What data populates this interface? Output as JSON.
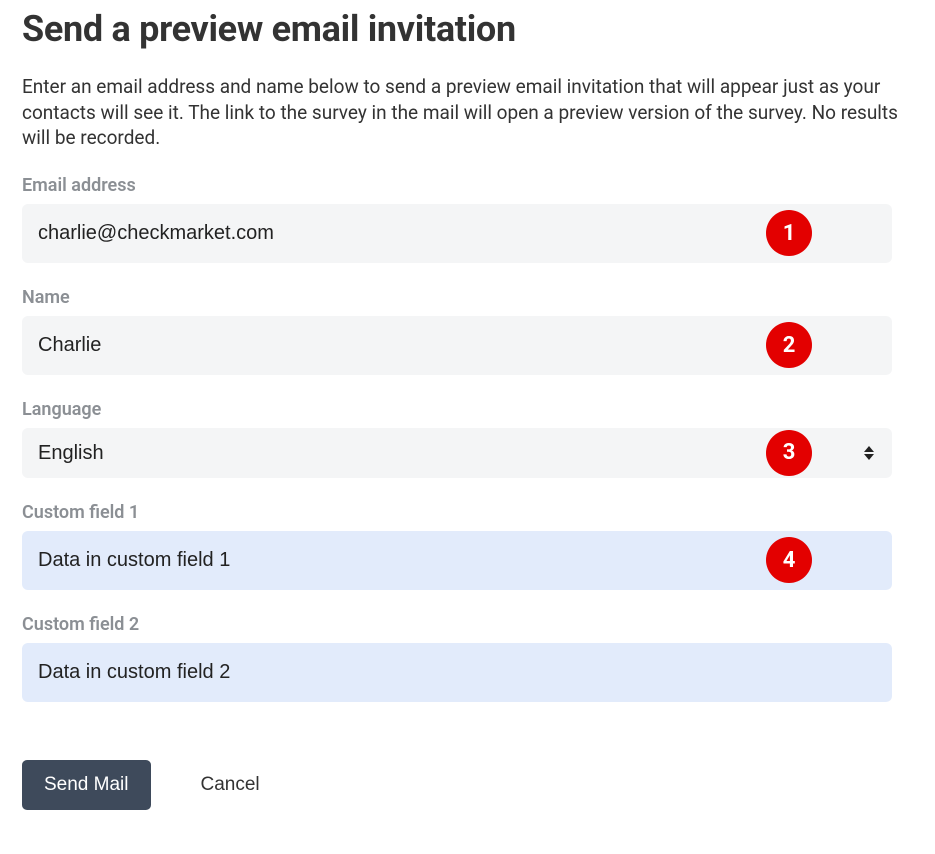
{
  "header": {
    "title": "Send a preview email invitation",
    "intro": "Enter an email address and name below to send a preview email invitation that will appear just as your contacts will see it. The link to the survey in the mail will open a preview version of the survey. No results will be recorded."
  },
  "fields": {
    "email": {
      "label": "Email address",
      "value": "charlie@checkmarket.com",
      "marker": "1"
    },
    "name": {
      "label": "Name",
      "value": "Charlie",
      "marker": "2"
    },
    "language": {
      "label": "Language",
      "value": "English",
      "marker": "3"
    },
    "custom1": {
      "label": "Custom field 1",
      "value": "Data in custom field 1",
      "marker": "4"
    },
    "custom2": {
      "label": "Custom field 2",
      "value": "Data in custom field 2"
    }
  },
  "actions": {
    "send_label": "Send Mail",
    "cancel_label": "Cancel"
  }
}
